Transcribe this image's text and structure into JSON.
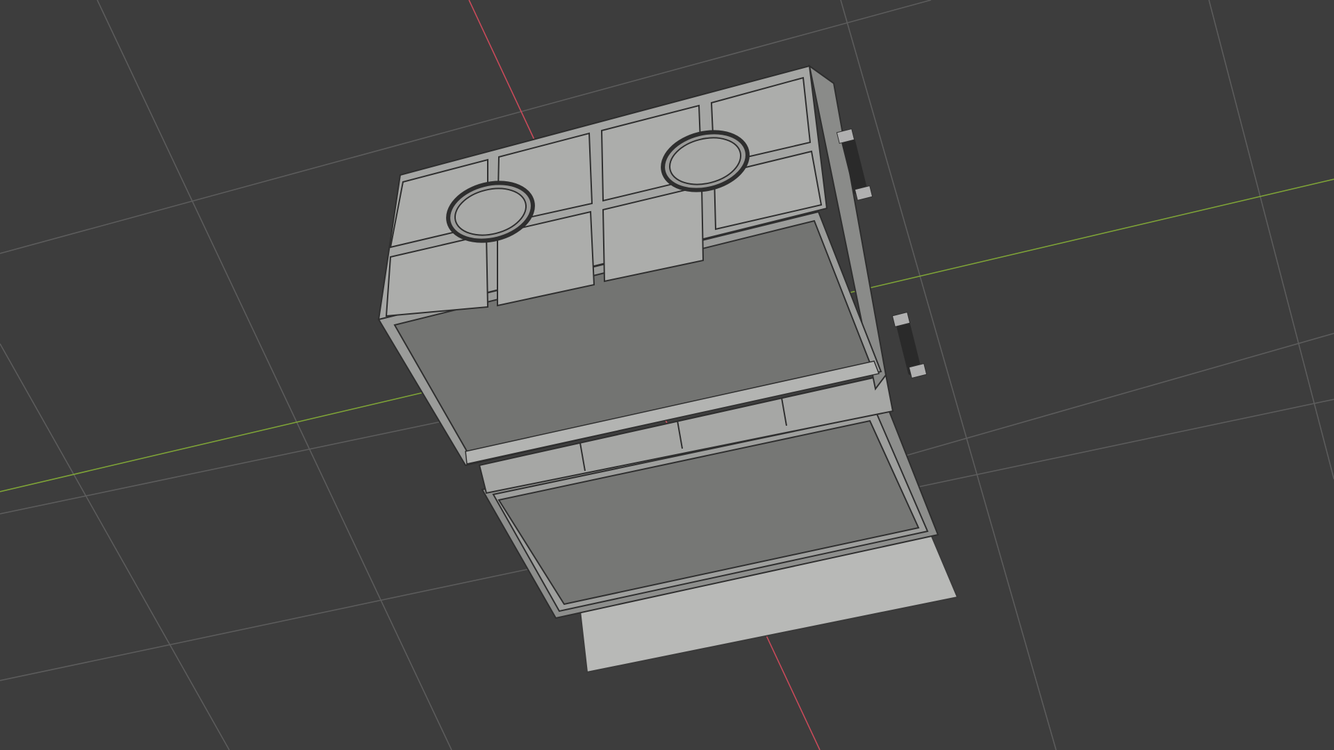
{
  "viewport": {
    "background": "#3d3d3d",
    "grid_color": "#5e5e5e",
    "x_axis_color": "#c94a5a",
    "y_axis_color": "#7ea337"
  },
  "scene": {
    "object": "model-cabinet-two-drawers",
    "shading": "solid",
    "wireframe_overlay": true,
    "body_color": "#9a9a9a",
    "face_light": "#a9aaa8",
    "face_dark": "#747573",
    "edge_color": "#2e2e2e"
  }
}
